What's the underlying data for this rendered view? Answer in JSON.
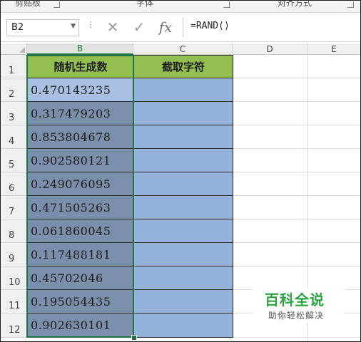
{
  "ribbon": {
    "groups": [
      "剪贴板",
      "字体",
      "对齐方式"
    ]
  },
  "formula_bar": {
    "name_box": "B2",
    "cancel_icon": "✕",
    "enter_icon": "✓",
    "fx_label": "fx",
    "formula": "=RAND()"
  },
  "columns": [
    "B",
    "C",
    "D",
    "E"
  ],
  "rows": [
    "1",
    "2",
    "3",
    "4",
    "5",
    "6",
    "7",
    "8",
    "9",
    "10",
    "11",
    "12"
  ],
  "table": {
    "header_b": "随机生成数",
    "header_c": "截取字符",
    "values": [
      "0.470143235",
      "0.317479203",
      "0.853804678",
      "0.902580121",
      "0.249076095",
      "0.471505263",
      "0.061860045",
      "0.117488181",
      "0.45702046",
      "0.195054435",
      "0.902630101"
    ]
  },
  "colors": {
    "header_green": "#92bf50",
    "selected_gray_blue": "#7b8fad",
    "active_cell": "#a9c0e2",
    "column_c_blue": "#94b2da",
    "selection_border": "#217346"
  },
  "watermark": {
    "title": "百科全说",
    "subtitle": "助你轻松解决"
  }
}
